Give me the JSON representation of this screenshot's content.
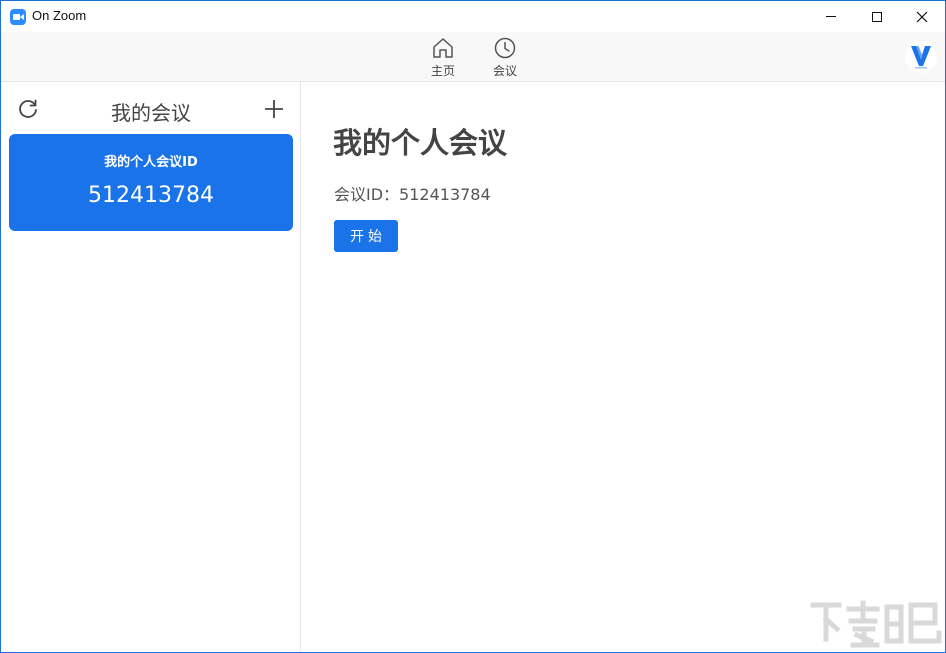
{
  "window": {
    "title": "On Zoom"
  },
  "titlebar": {
    "buttons": [
      {
        "name": "minimize",
        "icon": "minimize-icon"
      },
      {
        "name": "maximize",
        "icon": "maximize-icon"
      },
      {
        "name": "close",
        "icon": "close-icon"
      }
    ]
  },
  "nav": {
    "items": [
      {
        "label": "主页",
        "icon": "home-icon"
      },
      {
        "label": "会议",
        "icon": "clock-icon"
      }
    ],
    "avatar_letter": "V"
  },
  "sidebar": {
    "title": "我的会议",
    "refresh_icon": "refresh-icon",
    "add_icon": "plus-icon",
    "card": {
      "label": "我的个人会议ID",
      "meeting_id": "512413784"
    }
  },
  "detail": {
    "title": "我的个人会议",
    "meeting_id_label": "会议ID：",
    "meeting_id_value": "512413784",
    "start_label": "开始"
  },
  "colors": {
    "accent": "#1a73e8",
    "window_border": "#1e6fd9",
    "toolbar_bg": "#f8f8f8"
  }
}
